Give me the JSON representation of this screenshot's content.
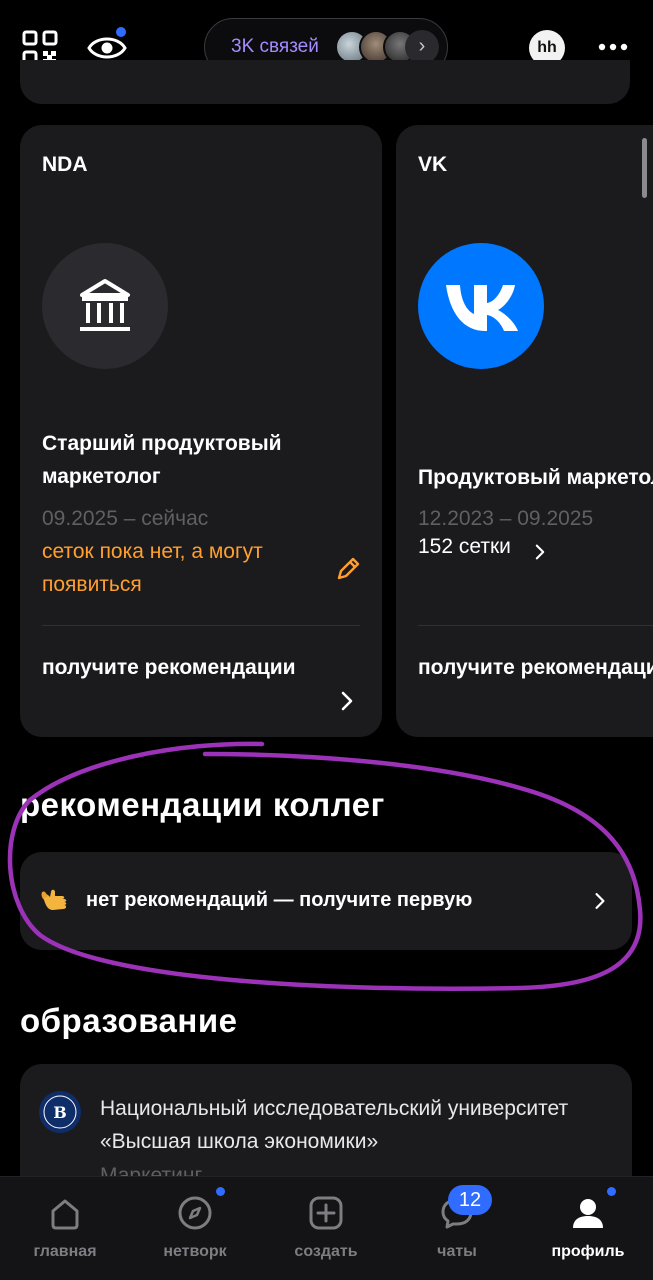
{
  "header": {
    "connections_label": "3K связей",
    "avatar_initials": "hh"
  },
  "experience": [
    {
      "company": "NDA",
      "logo_icon": "bank-building-icon",
      "role": "Старший продуктовый маркетолог",
      "period": "09.2025 – сейчас",
      "networks_status": "сеток пока нет, а могут появиться",
      "recommendations_link": "получите рекомендации"
    },
    {
      "company": "VK",
      "logo_icon": "vk-logo-icon",
      "role": "Продуктовый маркетолог",
      "period": "12.2023 – 09.2025",
      "networks_status": "152 сетки",
      "recommendations_link": "получите рекомендации"
    }
  ],
  "colleague_recs": {
    "title": "рекомендации коллег",
    "empty_text": "нет рекомендаций — получите первую",
    "emoji_icon": "call-me-hand-icon"
  },
  "education": {
    "title": "образование",
    "institution": "Национальный исследовательский университет «Высшая школа экономики»",
    "field": "Маркетинг",
    "logo_icon": "hse-logo-icon"
  },
  "bottom_nav": {
    "items": [
      {
        "label": "главная",
        "icon": "home-icon"
      },
      {
        "label": "нетворк",
        "icon": "compass-icon"
      },
      {
        "label": "создать",
        "icon": "plus-square-icon"
      },
      {
        "label": "чаты",
        "icon": "chat-icon",
        "badge": "12"
      },
      {
        "label": "профиль",
        "icon": "profile-icon"
      }
    ],
    "active": "профиль"
  },
  "colors": {
    "accent": "#2f6cff",
    "warning": "#ff9f2e",
    "connections": "#a58bff",
    "vk_brand": "#0077ff",
    "highlight_ellipse": "#9b32b8"
  }
}
